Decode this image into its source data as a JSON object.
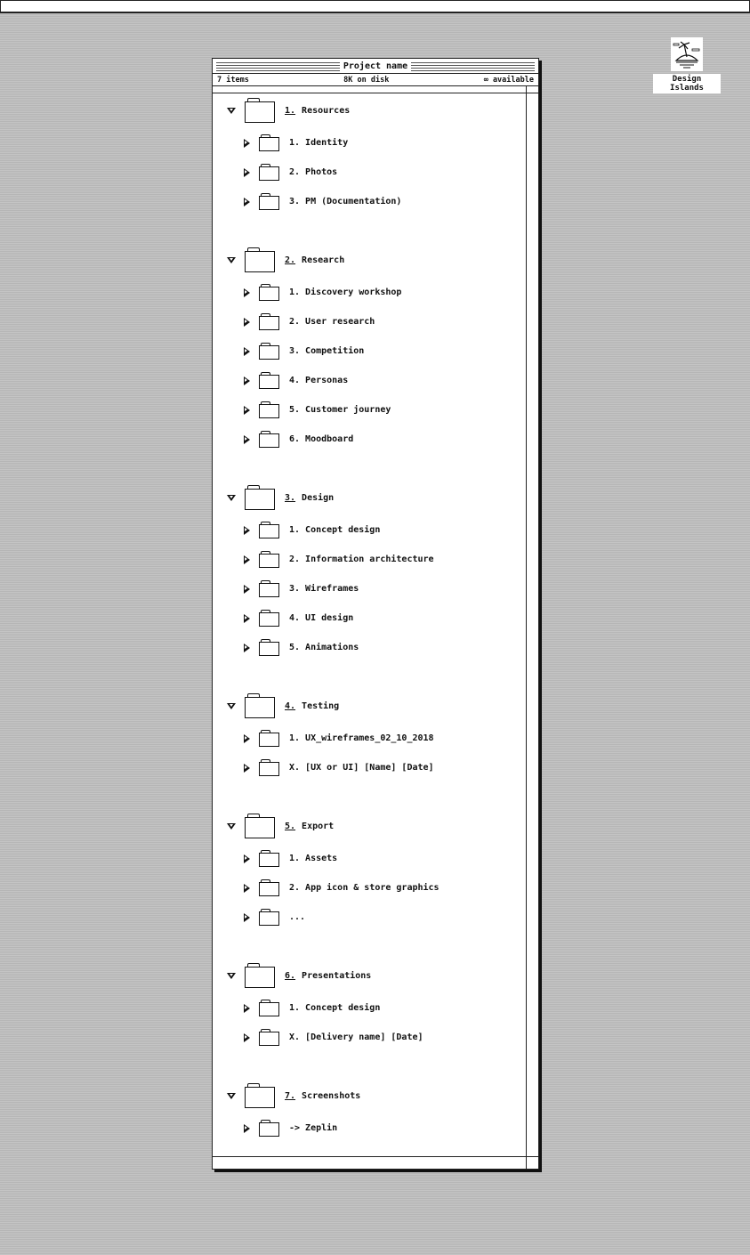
{
  "desktop": {
    "icon": {
      "name": "island-icon",
      "label": "Design Islands"
    }
  },
  "window": {
    "title": "Project name",
    "info": {
      "items": "7 items",
      "disk": "8K on disk",
      "available": "∞ available"
    }
  },
  "groups": [
    {
      "num": "1.",
      "label": "Resources",
      "children": [
        "1. Identity",
        "2. Photos",
        "3. PM (Documentation)"
      ]
    },
    {
      "num": "2.",
      "label": "Research",
      "children": [
        "1. Discovery workshop",
        "2. User research",
        "3. Competition",
        "4. Personas",
        "5. Customer journey",
        "6. Moodboard"
      ]
    },
    {
      "num": "3.",
      "label": "Design",
      "children": [
        "1. Concept design",
        "2. Information architecture",
        "3. Wireframes",
        "4. UI design",
        "5. Animations"
      ]
    },
    {
      "num": "4.",
      "label": "Testing",
      "children": [
        "1. UX_wireframes_02_10_2018",
        "X. [UX or UI] [Name] [Date]"
      ]
    },
    {
      "num": "5.",
      "label": "Export",
      "children": [
        "1. Assets",
        "2. App icon & store graphics",
        "..."
      ]
    },
    {
      "num": "6.",
      "label": "Presentations",
      "children": [
        "1. Concept design",
        "X. [Delivery name] [Date]"
      ]
    },
    {
      "num": "7.",
      "label": "Screenshots",
      "children": [
        "-> Zeplin"
      ]
    }
  ]
}
